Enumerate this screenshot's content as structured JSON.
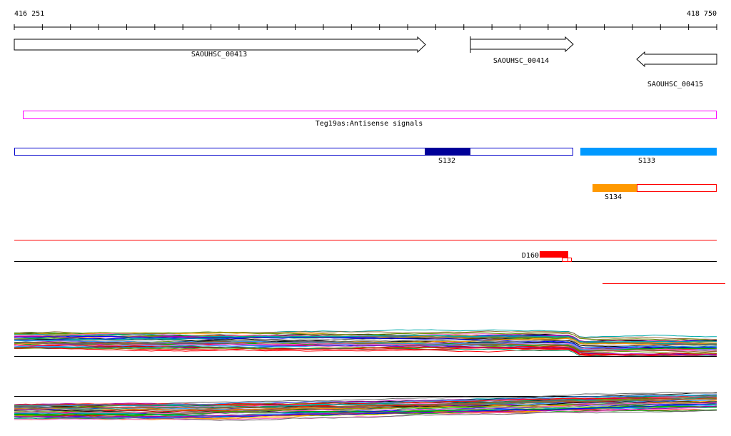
{
  "ruler": {
    "start_label": "416 251",
    "end_label": "418 750",
    "start": 416251,
    "end": 418750
  },
  "genes": [
    {
      "label": "SAOUHSC_00413",
      "strand": "+"
    },
    {
      "label": "SAOUHSC_00414",
      "strand": "+"
    },
    {
      "label": "SAOUHSC_00415",
      "strand": "-"
    }
  ],
  "annotation_track": {
    "label": "Teg19as:Antisense signals",
    "color": "#ff00ff"
  },
  "segments": [
    {
      "label": "S132",
      "color": "#000099",
      "outline": "#0000cc"
    },
    {
      "label": "S133",
      "color": "#0099ff"
    },
    {
      "label": "S134",
      "color": "#ff9900",
      "outline": "#ff0000"
    }
  ],
  "deletion": {
    "label": "D160",
    "color": "#ff0000"
  }
}
